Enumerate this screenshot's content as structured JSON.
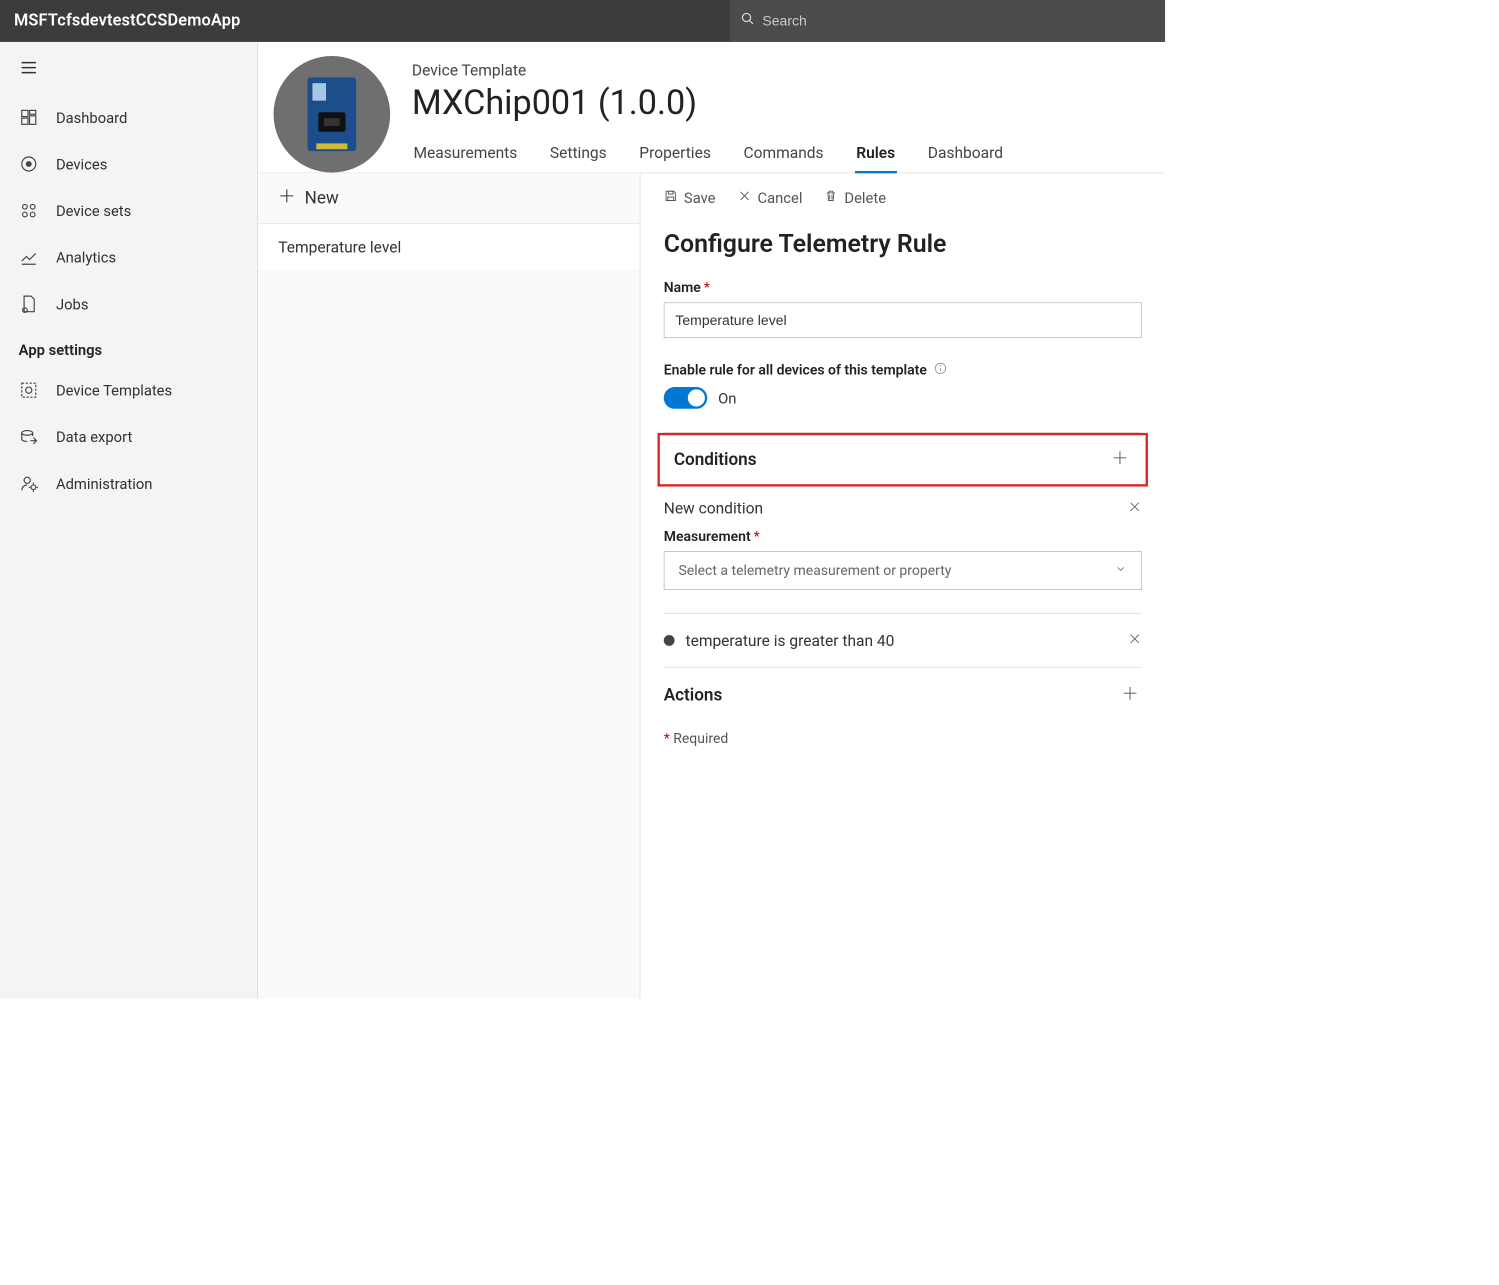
{
  "topbar": {
    "title": "MSFTcfsdevtestCCSDemoApp",
    "search_placeholder": "Search"
  },
  "sidebar": {
    "items": [
      {
        "label": "Dashboard"
      },
      {
        "label": "Devices"
      },
      {
        "label": "Device sets"
      },
      {
        "label": "Analytics"
      },
      {
        "label": "Jobs"
      }
    ],
    "section_title": "App settings",
    "settings": [
      {
        "label": "Device Templates"
      },
      {
        "label": "Data export"
      },
      {
        "label": "Administration"
      }
    ]
  },
  "header": {
    "crumb": "Device Template",
    "title": "MXChip001  (1.0.0)",
    "tabs": [
      {
        "label": "Measurements"
      },
      {
        "label": "Settings"
      },
      {
        "label": "Properties"
      },
      {
        "label": "Commands"
      },
      {
        "label": "Rules",
        "active": true
      },
      {
        "label": "Dashboard"
      }
    ]
  },
  "rules_list": {
    "new_label": "New",
    "items": [
      {
        "label": "Temperature level"
      }
    ]
  },
  "detail": {
    "toolbar": {
      "save": "Save",
      "cancel": "Cancel",
      "delete": "Delete"
    },
    "title": "Configure Telemetry Rule",
    "name_label": "Name",
    "name_value": "Temperature level",
    "enable_label": "Enable rule for all devices of this template",
    "enable_state": "On",
    "conditions": {
      "heading": "Conditions",
      "new_condition_label": "New condition",
      "measurement_label": "Measurement",
      "measurement_placeholder": "Select a telemetry measurement or property",
      "existing": "temperature is greater than 40"
    },
    "actions_heading": "Actions",
    "required_note": "Required"
  }
}
